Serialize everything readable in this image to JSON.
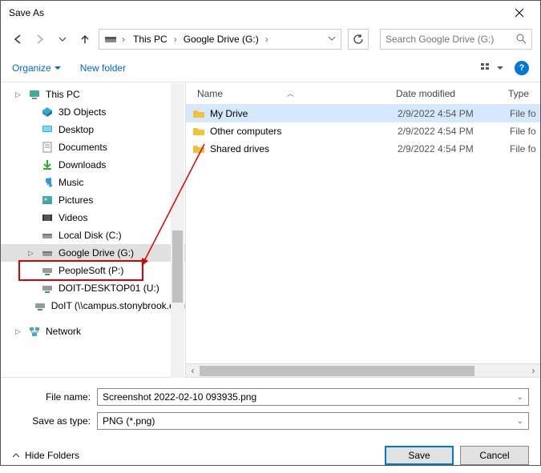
{
  "title": "Save As",
  "breadcrumb": [
    "This PC",
    "Google Drive (G:)"
  ],
  "search": {
    "placeholder": "Search Google Drive (G:)"
  },
  "toolbar": {
    "organize": "Organize",
    "new_folder": "New folder"
  },
  "columns": {
    "name": "Name",
    "date": "Date modified",
    "type": "Type"
  },
  "sidebar": [
    {
      "label": "This PC",
      "icon": "pc",
      "expandable": true,
      "child": false
    },
    {
      "label": "3D Objects",
      "icon": "3d",
      "child": true
    },
    {
      "label": "Desktop",
      "icon": "desktop",
      "child": true
    },
    {
      "label": "Documents",
      "icon": "documents",
      "child": true
    },
    {
      "label": "Downloads",
      "icon": "downloads",
      "child": true
    },
    {
      "label": "Music",
      "icon": "music",
      "child": true
    },
    {
      "label": "Pictures",
      "icon": "pictures",
      "child": true
    },
    {
      "label": "Videos",
      "icon": "videos",
      "child": true
    },
    {
      "label": "Local Disk (C:)",
      "icon": "disk",
      "child": true
    },
    {
      "label": "Google Drive (G:)",
      "icon": "gdrive",
      "child": true,
      "selected": true,
      "expandable": true
    },
    {
      "label": "PeopleSoft (P:)",
      "icon": "netdrive",
      "child": true
    },
    {
      "label": "DOIT-DESKTOP01 (U:)",
      "icon": "netdrive",
      "child": true
    },
    {
      "label": "DoIT (\\\\campus.stonybrook.edu",
      "icon": "netdrive",
      "child": true
    },
    {
      "label": "Network",
      "icon": "network",
      "expandable": true,
      "child": false,
      "gap": true
    }
  ],
  "files": [
    {
      "name": "My Drive",
      "date": "2/9/2022 4:54 PM",
      "type": "File fo",
      "selected": true
    },
    {
      "name": "Other computers",
      "date": "2/9/2022 4:54 PM",
      "type": "File fo"
    },
    {
      "name": "Shared drives",
      "date": "2/9/2022 4:54 PM",
      "type": "File fo"
    }
  ],
  "form": {
    "filename_label": "File name:",
    "filename_value": "Screenshot 2022-02-10 093935.png",
    "type_label": "Save as type:",
    "type_value": "PNG (*.png)"
  },
  "footer": {
    "hide": "Hide Folders",
    "save": "Save",
    "cancel": "Cancel"
  }
}
